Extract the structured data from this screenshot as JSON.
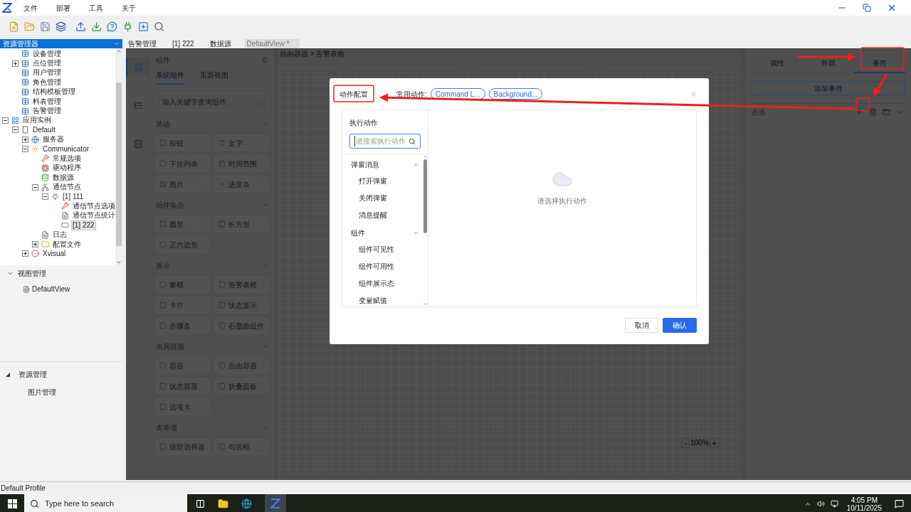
{
  "menu": [
    "文件",
    "部署",
    "工具",
    "关于"
  ],
  "explorer": {
    "title": "资源管理器",
    "tree_continued": [
      {
        "label": "设备管理",
        "kind": "table",
        "selected": false
      },
      {
        "label": "点位管理",
        "kind": "table",
        "expanded": false,
        "selected": false
      },
      {
        "label": "用户管理",
        "kind": "table",
        "selected": false
      },
      {
        "label": "角色管理",
        "kind": "table",
        "selected": false
      },
      {
        "label": "结构模板管理",
        "kind": "table",
        "selected": false
      },
      {
        "label": "料表管理",
        "kind": "table",
        "selected": false
      },
      {
        "label": "告警管理",
        "kind": "table",
        "selected": false
      }
    ],
    "tree": [
      {
        "label": "应用实例",
        "kind": "app",
        "expanded": true,
        "selected": false,
        "children": [
          {
            "label": "Default",
            "kind": "device",
            "expanded": true,
            "selected": false,
            "children": [
              {
                "label": "服务器",
                "kind": "globe",
                "expanded": false,
                "selected": false
              },
              {
                "label": "Communicator",
                "kind": "sun",
                "expanded": true,
                "selected": false,
                "children": [
                  {
                    "label": "常规选项",
                    "kind": "tools",
                    "selected": false
                  },
                  {
                    "label": "驱动程序",
                    "kind": "driver",
                    "selected": false
                  },
                  {
                    "label": "数据源",
                    "kind": "database",
                    "selected": false
                  },
                  {
                    "label": "通信节点",
                    "kind": "node",
                    "expanded": true,
                    "selected": false,
                    "children": [
                      {
                        "label": "[1] 111",
                        "kind": "plug",
                        "expanded": true,
                        "selected": false,
                        "children": [
                          {
                            "label": "通信节点选项",
                            "kind": "tools",
                            "selected": false
                          },
                          {
                            "label": "通信节点统计",
                            "kind": "doc",
                            "selected": false
                          },
                          {
                            "label": "[1] 222",
                            "kind": "port",
                            "selected": true
                          }
                        ]
                      }
                    ]
                  },
                  {
                    "label": "日志",
                    "kind": "doc",
                    "selected": false
                  },
                  {
                    "label": "配置文件",
                    "kind": "folder",
                    "expanded": false,
                    "selected": false
                  }
                ]
              },
              {
                "label": "Xvisual",
                "kind": "browser",
                "expanded": false,
                "selected": false
              }
            ]
          }
        ]
      }
    ]
  },
  "view_manager": {
    "title": "视图管理",
    "expanded": true,
    "items": [
      "DefaultView"
    ]
  },
  "resource_manager": {
    "title": "资源管理",
    "expanded": true,
    "items": [
      "图片管理"
    ]
  },
  "doc_tabs": [
    {
      "label": "告警管理",
      "selected": false
    },
    {
      "label": "[1] 222",
      "selected": false
    },
    {
      "label": "数据源",
      "selected": false
    },
    {
      "label": "DefaultView *",
      "selected": true
    }
  ],
  "rail": [
    {
      "kind": "grid",
      "selected": true
    },
    {
      "kind": "tree",
      "selected": false
    },
    {
      "kind": "code",
      "selected": false
    }
  ],
  "components": {
    "title": "组件",
    "tabs": [
      {
        "label": "系统组件",
        "selected": true
      },
      {
        "label": "页面视图",
        "selected": false
      }
    ],
    "search_placeholder": "输入关键字查询组件",
    "groups": [
      {
        "title": "基础",
        "items": [
          "按钮",
          "文字",
          "下拉列表",
          "时间范围",
          "图片",
          "进度条"
        ]
      },
      {
        "title": "组件集合",
        "items": [
          "圆形",
          "长方形",
          "正六边形"
        ]
      },
      {
        "title": "展示",
        "items": [
          "象棋",
          "告警表格",
          "卡片",
          "状态显示",
          "步骤条",
          "石墨曲组件"
        ]
      },
      {
        "title": "布局容器",
        "items": [
          "容器",
          "自由容器",
          "状态容器",
          "折叠面板",
          "选项卡"
        ]
      },
      {
        "title": "表单项",
        "items": [
          "级联选择器",
          "勾选框"
        ]
      }
    ]
  },
  "canvas": {
    "breadcrumb": "自由容器 > 告警表格",
    "zoom_out": "-",
    "zoom": "100%",
    "zoom_in": "+"
  },
  "properties": {
    "tabs": [
      {
        "label": "属性",
        "selected": false
      },
      {
        "label": "外观",
        "selected": false
      },
      {
        "label": "事件",
        "selected": true
      }
    ],
    "add_button": "添加事件",
    "events": [
      {
        "label": "点击"
      }
    ]
  },
  "dialog": {
    "title": "动作配置",
    "common_label": "常用动作:",
    "common_actions": [
      "Command L...",
      "Background..."
    ],
    "section_title": "执行动作",
    "search_placeholder": "请搜索执行动作",
    "groups": [
      {
        "title": "弹窗消息",
        "expanded": true,
        "items": [
          "打开弹窗",
          "关闭弹窗",
          "消息提醒"
        ]
      },
      {
        "title": "组件",
        "expanded": true,
        "items": [
          "组件可见性",
          "组件可用性",
          "组件展示态",
          "变量赋值"
        ]
      }
    ],
    "empty_text": "请选择执行动作",
    "cancel": "取消",
    "confirm": "确认"
  },
  "status_bar": "Default Profile",
  "taskbar": {
    "search_placeholder": "Type here to search",
    "time": "4:05 PM",
    "date": "10/11/2025"
  }
}
